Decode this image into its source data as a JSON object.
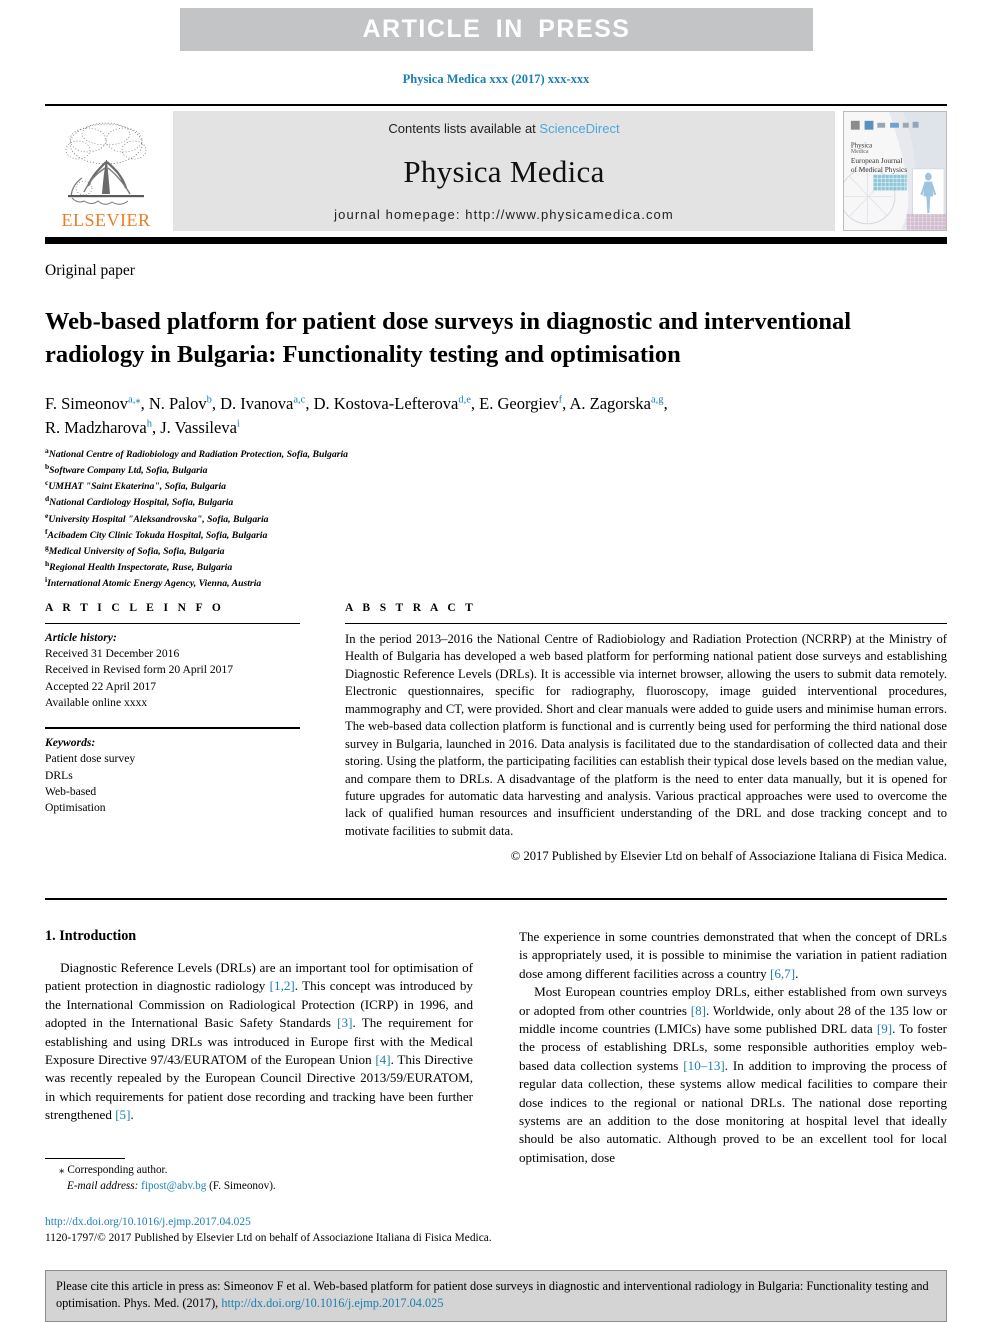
{
  "banner": {
    "text": "ARTICLE  IN  PRESS"
  },
  "journal_ref": "Physica Medica xxx (2017) xxx-xxx",
  "masthead": {
    "contents_prefix": "Contents lists available at ",
    "sciencedirect": "ScienceDirect",
    "journal_title": "Physica Medica",
    "homepage": "journal homepage: http://www.physicamedica.com",
    "publisher_word": "ELSEVIER",
    "cover_title_1": "Physica",
    "cover_title_2": "Medica",
    "cover_sub_1": "European Journal",
    "cover_sub_2": "of Medical Physics"
  },
  "article": {
    "type": "Original paper",
    "title": "Web-based platform for patient dose surveys in diagnostic and interventional radiology in Bulgaria: Functionality testing and optimisation",
    "authors_line_1": "F. Simeonov [a,*], N. Palov [b], D. Ivanova [a,c], D. Kostova-Lefterova [d,e], E. Georgiev [f], A. Zagorska [a,g],",
    "authors_line_2": "R. Madzharova [h], J. Vassileva [i]",
    "affiliations": [
      {
        "mark": "a",
        "text": "National Centre of Radiobiology and Radiation Protection, Sofia, Bulgaria"
      },
      {
        "mark": "b",
        "text": "Software Company Ltd, Sofia, Bulgaria"
      },
      {
        "mark": "c",
        "text": "UMHAT \"Saint Ekaterina\", Sofia, Bulgaria"
      },
      {
        "mark": "d",
        "text": "National Cardiology Hospital, Sofia, Bulgaria"
      },
      {
        "mark": "e",
        "text": "University Hospital \"Aleksandrovska\", Sofia, Bulgaria"
      },
      {
        "mark": "f",
        "text": "Acibadem City Clinic Tokuda Hospital, Sofia, Bulgaria"
      },
      {
        "mark": "g",
        "text": "Medical University of Sofia, Sofia, Bulgaria"
      },
      {
        "mark": "h",
        "text": "Regional Health Inspectorate, Ruse, Bulgaria"
      },
      {
        "mark": "i",
        "text": "International Atomic Energy Agency, Vienna, Austria"
      }
    ]
  },
  "info": {
    "heading": "A R T I C L E   I N F O",
    "history_label": "Article history:",
    "history": [
      "Received 31 December 2016",
      "Received in Revised form 20 April 2017",
      "Accepted 22 April 2017",
      "Available online xxxx"
    ],
    "keywords_label": "Keywords:",
    "keywords": [
      "Patient dose survey",
      "DRLs",
      "Web-based",
      "Optimisation"
    ]
  },
  "abstract": {
    "heading": "A B S T R A C T",
    "text": "In the period 2013–2016 the National Centre of Radiobiology and Radiation Protection (NCRRP) at the Ministry of Health of Bulgaria has developed a web based platform for performing national patient dose surveys and establishing Diagnostic Reference Levels (DRLs). It is accessible via internet browser, allowing the users to submit data remotely. Electronic questionnaires, specific for radiography, fluoroscopy, image guided interventional procedures, mammography and CT, were provided. Short and clear manuals were added to guide users and minimise human errors. The web-based data collection platform is functional and is currently being used for performing the third national dose survey in Bulgaria, launched in 2016. Data analysis is facilitated due to the standardisation of collected data and their storing. Using the platform, the participating facilities can establish their typical dose levels based on the median value, and compare them to DRLs. A disadvantage of the platform is the need to enter data manually, but it is opened for future upgrades for automatic data harvesting and analysis. Various practical approaches were used to overcome the lack of qualified human resources and insufficient understanding of the DRL and dose tracking concept and to motivate facilities to submit data.",
    "copyright": "© 2017 Published by Elsevier Ltd on behalf of Associazione Italiana di Fisica Medica."
  },
  "body": {
    "section_heading": "1. Introduction",
    "left_paragraphs": [
      "Diagnostic Reference Levels (DRLs) are an important tool for optimisation of patient protection in diagnostic radiology [1,2]. This concept was introduced by the International Commission on Radiological Protection (ICRP) in 1996, and adopted in the International Basic Safety Standards [3]. The requirement for establishing and using DRLs was introduced in Europe first with the Medical Exposure Directive 97/43/EURATOM of the European Union [4]. This Directive was recently repealed by the European Council Directive 2013/59/EURATOM, in which requirements for patient dose recording and tracking have been further strengthened [5]."
    ],
    "right_paragraphs": [
      "The experience in some countries demonstrated that when the concept of DRLs is appropriately used, it is possible to minimise the variation in patient radiation dose among different facilities across a country [6,7].",
      "Most European countries employ DRLs, either established from own surveys or adopted from other countries [8]. Worldwide, only about 28 of the 135 low or middle income countries (LMICs) have some published DRL data [9]. To foster the process of establishing DRLs, some responsible authorities employ web-based data collection systems [10–13]. In addition to improving the process of regular data collection, these systems allow medical facilities to compare their dose indices to the regional or national DRLs. The national dose reporting systems are an addition to the dose monitoring at hospital level that ideally should be also automatic. Although proved to be an excellent tool for local optimisation, dose"
    ]
  },
  "footnote": {
    "star": "⁎",
    "corresponding": "Corresponding author.",
    "email_label": "E-mail address:",
    "email": "fipost@abv.bg",
    "email_owner": "(F. Simeonov)."
  },
  "doi_block": {
    "doi_url": "http://dx.doi.org/10.1016/j.ejmp.2017.04.025",
    "issn_line": "1120-1797/© 2017 Published by Elsevier Ltd on behalf of Associazione Italiana di Fisica Medica."
  },
  "cite_box": {
    "text_before": "Please cite this article in press as: Simeonov F et al. Web-based platform for patient dose surveys in diagnostic and interventional radiology in Bulgaria: Functionality testing and optimisation. Phys. Med. (2017), ",
    "link": "http://dx.doi.org/10.1016/j.ejmp.2017.04.025"
  },
  "colors": {
    "link": "#1a7fb3",
    "sciencedirect": "#4ea6dd",
    "elsevier_orange": "#ec7d25",
    "banner_bg": "#c3c4c6",
    "masthead_bg": "#e3e3e3",
    "cite_bg": "#d4d4d4"
  }
}
